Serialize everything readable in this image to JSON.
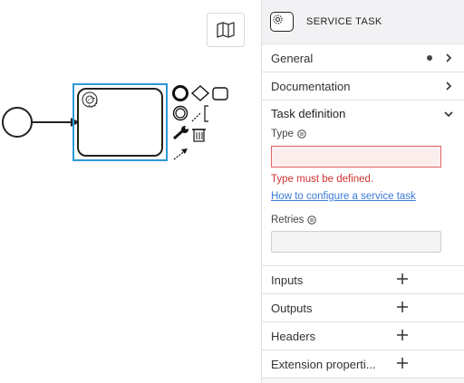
{
  "panel": {
    "header_title": "SERVICE TASK",
    "groups_top": [
      {
        "label": "General",
        "has_dot": true
      },
      {
        "label": "Documentation",
        "has_dot": false
      }
    ],
    "task_definition": {
      "title": "Task definition",
      "type_label": "Type",
      "type_value": "",
      "type_error": "Type must be defined.",
      "help_link": "How to configure a service task",
      "retries_label": "Retries",
      "retries_value": ""
    },
    "groups_bottom": [
      {
        "label": "Inputs"
      },
      {
        "label": "Outputs"
      },
      {
        "label": "Headers"
      },
      {
        "label": "Extension properti..."
      }
    ]
  },
  "icons": [
    "map-icon",
    "gear-icon",
    "chevron-right-icon",
    "chevron-down-icon",
    "plus-icon",
    "info-icon",
    "wrench-icon",
    "trash-icon"
  ],
  "colors": {
    "selection": "#2e97d8",
    "error": "#d23232",
    "link": "#3b7bd8"
  }
}
